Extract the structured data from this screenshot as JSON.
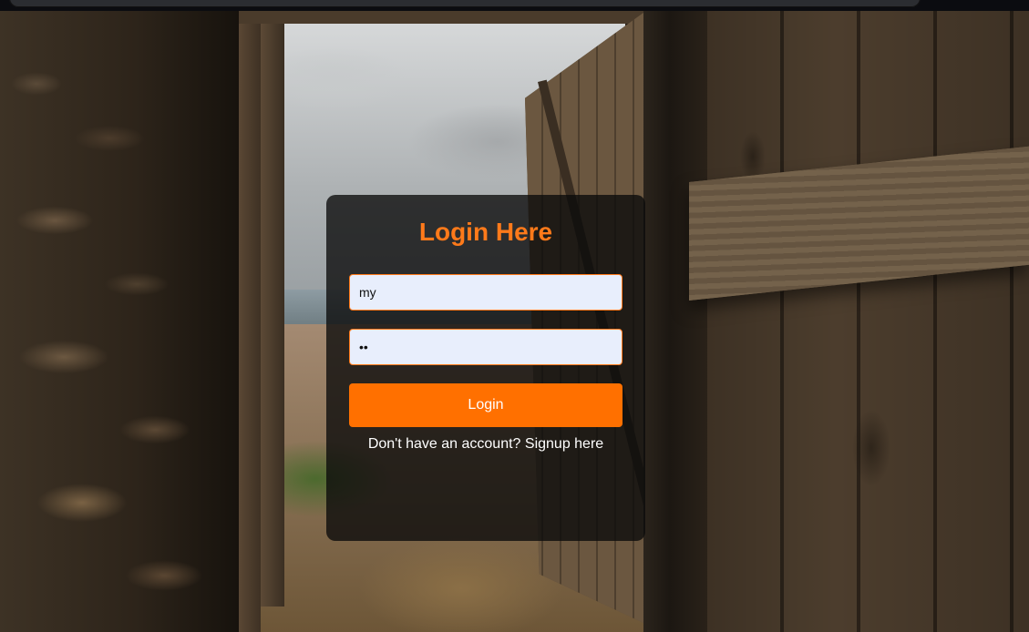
{
  "login": {
    "title": "Login Here",
    "username_value": "my",
    "password_value": "12",
    "button_label": "Login",
    "signup_prompt": "Don't have an account?",
    "signup_link": "Signup here"
  },
  "colors": {
    "accent": "#ff7000",
    "title": "#ff7a1a",
    "input_bg": "#e8eefc",
    "card_bg": "rgba(10,10,10,0.78)"
  }
}
